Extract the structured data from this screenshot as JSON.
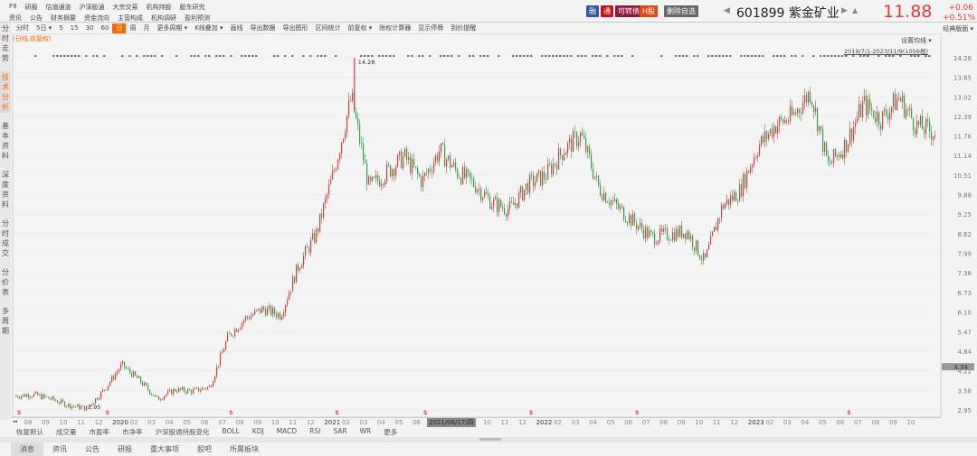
{
  "nav_row1": [
    "F9",
    "研报",
    "估值通道",
    "沪深股通",
    "大宗交易",
    "机构持股",
    "股东研究"
  ],
  "nav_row2": [
    "资讯",
    "公告",
    "财务摘要",
    "资金流向",
    "主营构成",
    "机构调研",
    "盈利预测"
  ],
  "badges": [
    {
      "label": "融",
      "color": "#2b5aa8"
    },
    {
      "label": "通",
      "color": "#c0131f"
    },
    {
      "label": "可转债",
      "color": "#8b1a3c"
    },
    {
      "label": "H股",
      "color": "#e04a12"
    },
    {
      "label": "删除自选",
      "color": "#666666"
    }
  ],
  "stock": {
    "code": "601899",
    "name": "紫金矿业",
    "price": "11.88",
    "change": "+0.06",
    "change_pct": "+0.51%"
  },
  "toolbar": [
    "分时",
    "5日 ▾",
    "5",
    "15",
    "30",
    "60",
    "日",
    "周",
    "月",
    "更多周期 ▾",
    "K线叠加 ▾",
    "画线",
    "导出数据",
    "导出图形",
    "区间统计",
    "前复权 ▾",
    "除权计算器",
    "显示停牌",
    "到价提醒"
  ],
  "toolbar_active": "日",
  "layout_menu": "经典版面 ▾",
  "sidebar": [
    "分时走势",
    "技术分析",
    "基本资料",
    "深度资料",
    "分时成交",
    "分价表",
    "多周期"
  ],
  "sidebar_active": "技术分析",
  "chart_subtitle": "(日线,前复权)",
  "ma_setting": "设置均线 ▾",
  "range_label": "2019/7/1-2023/11/9(1056根)",
  "high_label": "14.28",
  "low_label": "2.95",
  "crosshair_price": "4.34",
  "crosshair_date": "2021/06/17/四",
  "indicator_tabs": [
    "恢复默认",
    "成交量",
    "市盈率",
    "市净率",
    "沪深股通持股变化",
    "BOLL",
    "KDJ",
    "MACD",
    "RSI",
    "SAR",
    "WR",
    "更多"
  ],
  "bottom_tabs": [
    "消息",
    "资讯",
    "公告",
    "研报",
    "重大事项",
    "股吧",
    "所属板块"
  ],
  "colors": {
    "up": "#e8373b",
    "down": "#2ea24a",
    "accent": "#ff6600"
  },
  "chart_data": {
    "type": "candlestick",
    "title": "601899 紫金矿业 日线 前复权",
    "y_ticks": [
      14.28,
      13.65,
      13.02,
      12.39,
      11.76,
      11.14,
      10.51,
      9.88,
      9.25,
      8.62,
      7.99,
      7.36,
      6.73,
      6.1,
      5.47,
      4.84,
      4.21,
      3.58,
      2.95
    ],
    "ylim": [
      2.95,
      14.28
    ],
    "x_labels": [
      "08",
      "09",
      "10",
      "11",
      "12",
      "2020",
      "02",
      "03",
      "04",
      "05",
      "06",
      "07",
      "08",
      "09",
      "10",
      "11",
      "12",
      "2021",
      "02",
      "03",
      "04",
      "05",
      "06",
      "07",
      "08",
      "09",
      "10",
      "11",
      "12",
      "2022",
      "02",
      "03",
      "04",
      "05",
      "06",
      "07",
      "08",
      "09",
      "10",
      "11",
      "12",
      "2023",
      "02",
      "03",
      "04",
      "05",
      "06",
      "07",
      "08",
      "09",
      "10"
    ],
    "monthly_close": [
      [
        "2019-07",
        3.4
      ],
      [
        "2019-08",
        3.45
      ],
      [
        "2019-09",
        3.3
      ],
      [
        "2019-10",
        3.1
      ],
      [
        "2019-11",
        3.0
      ],
      [
        "2019-12",
        3.6
      ],
      [
        "2020-01",
        4.4
      ],
      [
        "2020-02",
        3.9
      ],
      [
        "2020-03",
        3.3
      ],
      [
        "2020-04",
        3.6
      ],
      [
        "2020-05",
        3.55
      ],
      [
        "2020-06",
        3.7
      ],
      [
        "2020-07",
        5.3
      ],
      [
        "2020-08",
        5.9
      ],
      [
        "2020-09",
        6.2
      ],
      [
        "2020-10",
        6.0
      ],
      [
        "2020-11",
        7.6
      ],
      [
        "2020-12",
        8.6
      ],
      [
        "2021-01",
        10.6
      ],
      [
        "2021-02",
        13.0
      ],
      [
        "2021-03",
        10.1
      ],
      [
        "2021-04",
        10.6
      ],
      [
        "2021-05",
        11.1
      ],
      [
        "2021-06",
        10.3
      ],
      [
        "2021-07",
        11.3
      ],
      [
        "2021-08",
        10.6
      ],
      [
        "2021-09",
        10.2
      ],
      [
        "2021-10",
        9.6
      ],
      [
        "2021-11",
        9.4
      ],
      [
        "2021-12",
        10.2
      ],
      [
        "2022-01",
        10.5
      ],
      [
        "2022-02",
        11.3
      ],
      [
        "2022-03",
        11.8
      ],
      [
        "2022-04",
        10.1
      ],
      [
        "2022-05",
        9.5
      ],
      [
        "2022-06",
        9.0
      ],
      [
        "2022-07",
        8.5
      ],
      [
        "2022-08",
        8.6
      ],
      [
        "2022-09",
        8.7
      ],
      [
        "2022-10",
        7.7
      ],
      [
        "2022-11",
        9.5
      ],
      [
        "2022-12",
        10.0
      ],
      [
        "2023-01",
        11.4
      ],
      [
        "2023-02",
        12.1
      ],
      [
        "2023-03",
        12.4
      ],
      [
        "2023-04",
        13.2
      ],
      [
        "2023-05",
        10.8
      ],
      [
        "2023-06",
        11.5
      ],
      [
        "2023-07",
        12.8
      ],
      [
        "2023-08",
        12.3
      ],
      [
        "2023-09",
        13.0
      ],
      [
        "2023-10",
        12.1
      ],
      [
        "2023-11",
        11.88
      ]
    ],
    "dividend_markers": [
      "2019-07",
      "2019-12",
      "2020-07",
      "2021-01",
      "2021-06",
      "2021-12",
      "2022-06",
      "2023-06"
    ]
  }
}
